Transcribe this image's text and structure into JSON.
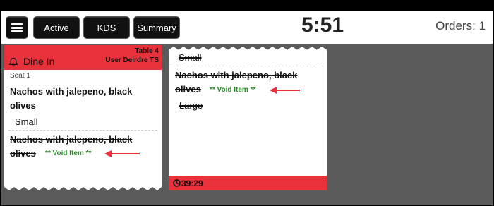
{
  "topbar": {
    "buttons": {
      "active": "Active",
      "kds": "KDS",
      "summary": "Summary"
    },
    "clock": "5:51",
    "orders_count": "Orders: 1"
  },
  "ticket1": {
    "order_type": "Dine In",
    "table": "Table 4",
    "user": "User Deirdre TS",
    "seat": "Seat 1",
    "item1": {
      "name_line1": "Nachos with jalepeno, black",
      "name_line2": "olives",
      "modifier": "Small"
    },
    "item2": {
      "name_line1": "Nachos with jalepeno, black",
      "name_line2": "olives",
      "status": "** Void Item **"
    }
  },
  "ticket2": {
    "modifier_top": "Small",
    "item": {
      "name_line1": "Nachos with jalepeno, black",
      "name_line2": "olives",
      "status": "** Void Item **",
      "modifier": "Large"
    },
    "timer": "39:29"
  },
  "colors": {
    "header_red": "#e8313a",
    "void_green": "#2a8a2a",
    "annotation_arrow": "#e8313a"
  }
}
